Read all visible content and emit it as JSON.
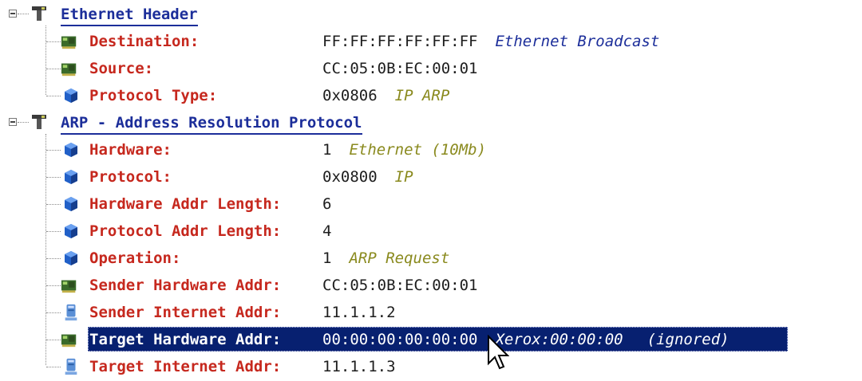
{
  "tree": {
    "ethernet_header": {
      "title": "Ethernet Header",
      "fields": [
        {
          "name": "Destination:",
          "value": "FF:FF:FF:FF:FF:FF",
          "desc": "Ethernet Broadcast",
          "icon": "network-card-icon"
        },
        {
          "name": "Source:",
          "value": "CC:05:0B:EC:00:01",
          "desc": "",
          "icon": "network-card-icon"
        },
        {
          "name": "Protocol Type:",
          "value": "0x0806",
          "desc": "IP ARP",
          "icon": "blue-cube-icon"
        }
      ]
    },
    "arp": {
      "title": "ARP - Address Resolution Protocol",
      "fields": [
        {
          "name": "Hardware:",
          "value": "1",
          "desc": "Ethernet (10Mb)",
          "icon": "blue-cube-icon"
        },
        {
          "name": "Protocol:",
          "value": "0x0800",
          "desc": "IP",
          "icon": "blue-cube-icon"
        },
        {
          "name": "Hardware Addr Length:",
          "value": "6",
          "desc": "",
          "icon": "blue-cube-icon"
        },
        {
          "name": "Protocol Addr Length:",
          "value": "4",
          "desc": "",
          "icon": "blue-cube-icon"
        },
        {
          "name": "Operation:",
          "value": "1",
          "desc": "ARP Request",
          "icon": "blue-cube-icon"
        },
        {
          "name": "Sender Hardware Addr:",
          "value": "CC:05:0B:EC:00:01",
          "desc": "",
          "icon": "network-card-icon"
        },
        {
          "name": "Sender Internet Addr:",
          "value": "11.1.1.2",
          "desc": "",
          "icon": "computer-icon"
        },
        {
          "name": "Target Hardware Addr:",
          "value": "00:00:00:00:00:00",
          "desc": "Xerox:00:00:00",
          "desc2": "(ignored)",
          "icon": "network-card-icon",
          "selected": true
        },
        {
          "name": "Target Internet Addr:",
          "value": "11.1.1.3",
          "desc": "",
          "icon": "computer-icon"
        }
      ]
    }
  },
  "colors": {
    "header": "#1c2e9a",
    "field_name": "#c6281e",
    "desc": "#8a8a1e",
    "selection": "#072070"
  }
}
